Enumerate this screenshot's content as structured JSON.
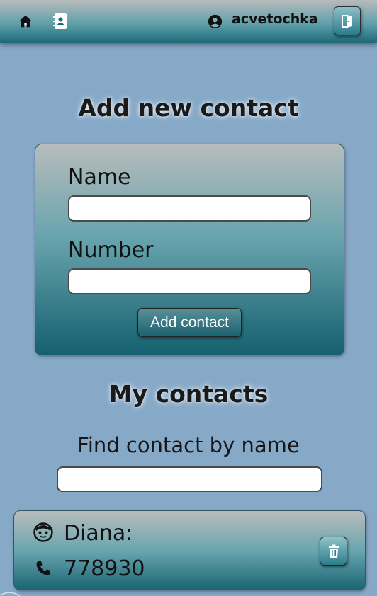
{
  "header": {
    "nav": [
      {
        "icon": "home-icon"
      },
      {
        "icon": "contacts-book-icon"
      }
    ],
    "user": {
      "icon": "user-circle-icon",
      "name": "acvetochka"
    },
    "logout_icon": "logout-door-icon"
  },
  "add_form": {
    "title": "Add new contact",
    "name_label": "Name",
    "name_value": "",
    "number_label": "Number",
    "number_value": "",
    "submit_label": "Add contact"
  },
  "contacts": {
    "title": "My contacts",
    "filter_label": "Find contact by name",
    "filter_value": "",
    "items": [
      {
        "name": "Diana:",
        "number": "778930",
        "name_icon": "face-icon",
        "number_icon": "phone-icon",
        "delete_icon": "trash-icon"
      }
    ]
  },
  "colors": {
    "background": "#87a9c8",
    "accent_dark": "#15606f",
    "accent_light": "#b7bcbc"
  }
}
